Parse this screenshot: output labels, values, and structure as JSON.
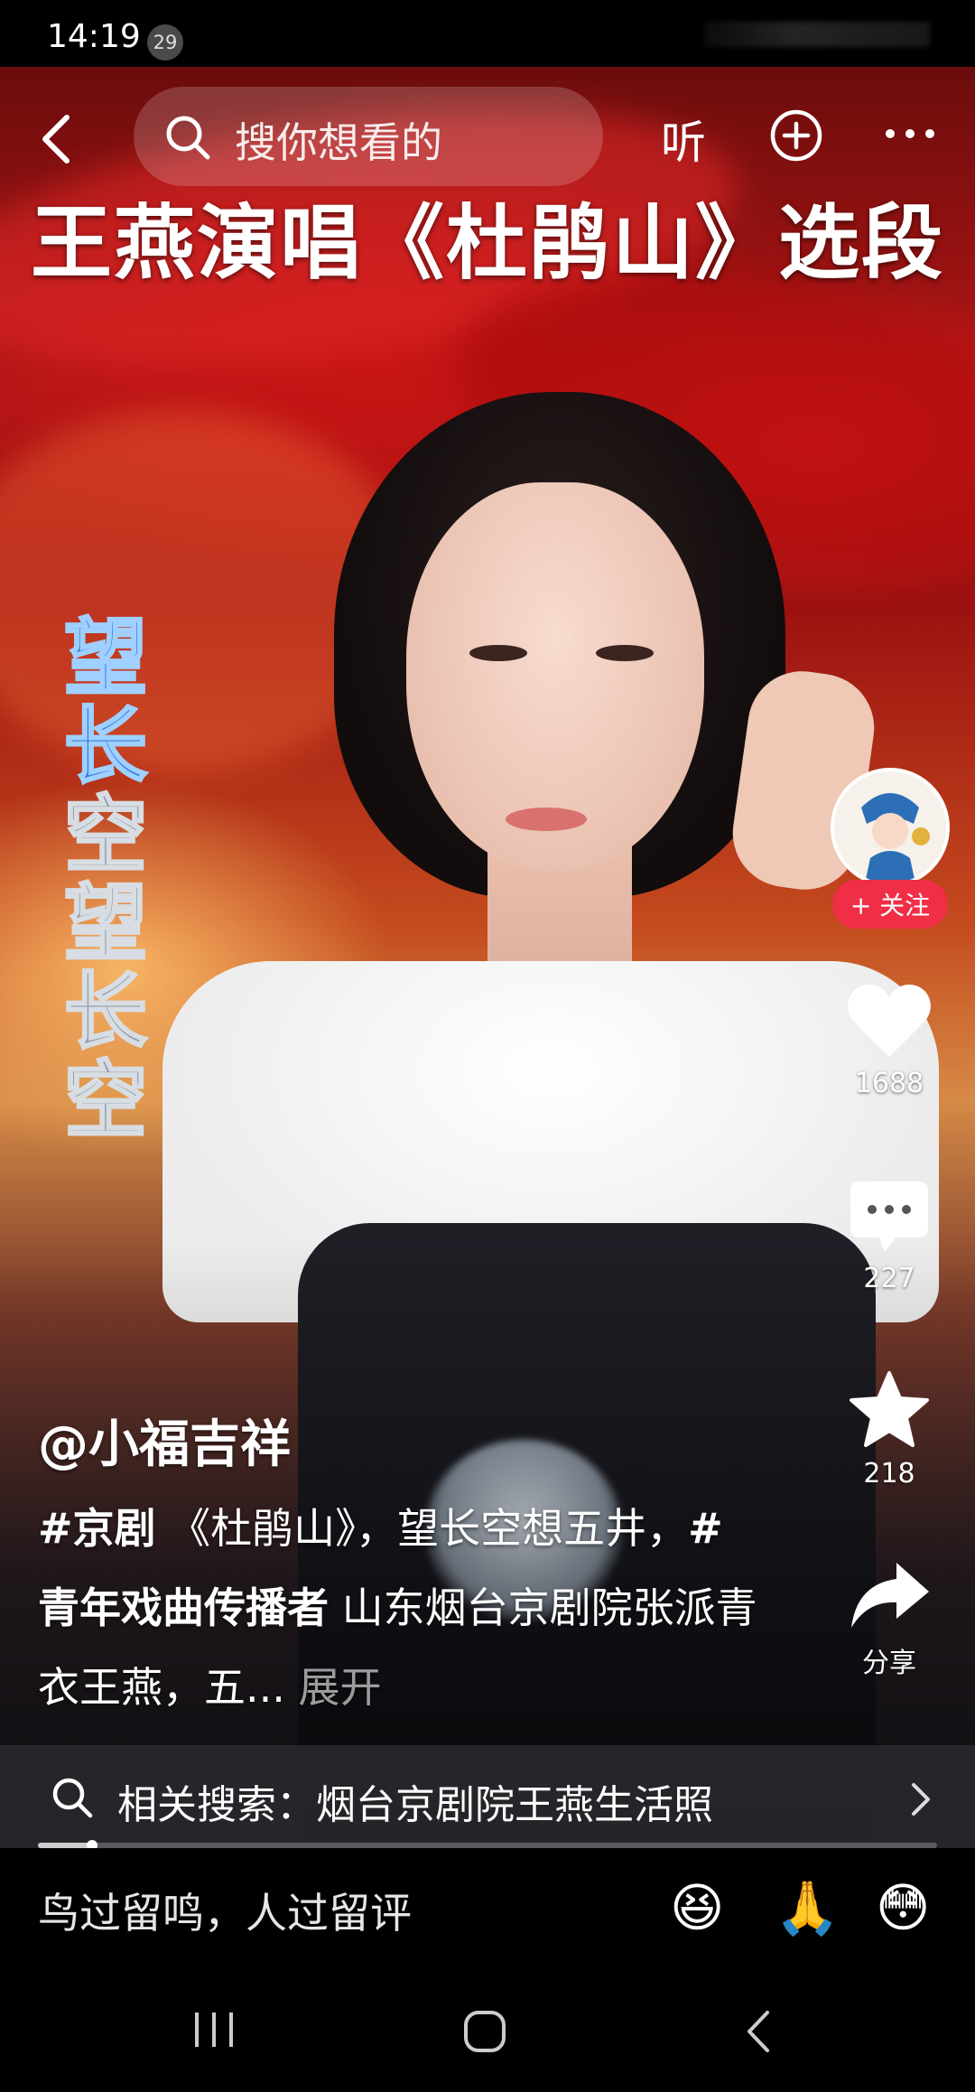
{
  "status_bar": {
    "time": "14:19",
    "notification_count": "29"
  },
  "top_nav": {
    "search_placeholder": "搜你想看的",
    "listen_label": "听",
    "back_icon": "chevron-left-icon",
    "add_icon": "plus-circle-icon",
    "more_icon": "more-horizontal-icon"
  },
  "video": {
    "title": "王燕演唱《杜鹃山》选段",
    "lyric_highlight": "望长",
    "lyric_rest": "空望长空"
  },
  "actions": {
    "follow_label": "+ 关注",
    "like_count": "1688",
    "comment_count": "227",
    "favorite_count": "218",
    "share_label": "分享"
  },
  "caption": {
    "author": "@小福吉祥",
    "tag1": "#京剧",
    "text1": " 《杜鹃山》，望长空想五井，",
    "tag2": "#青年戏曲传播者",
    "text2": " 山东烟台京剧院张派青衣王燕，五...",
    "expand": " 展开"
  },
  "related_search": {
    "text": "相关搜索：烟台京剧院王燕生活照",
    "progress_fraction": 0.06
  },
  "comment_bar": {
    "placeholder": "鸟过留鸣，人过留评",
    "emojis": [
      "😆",
      "🙏",
      "😳"
    ]
  },
  "colors": {
    "follow_red": "#f02e45",
    "lyric_blue": "#3a7bd9"
  }
}
